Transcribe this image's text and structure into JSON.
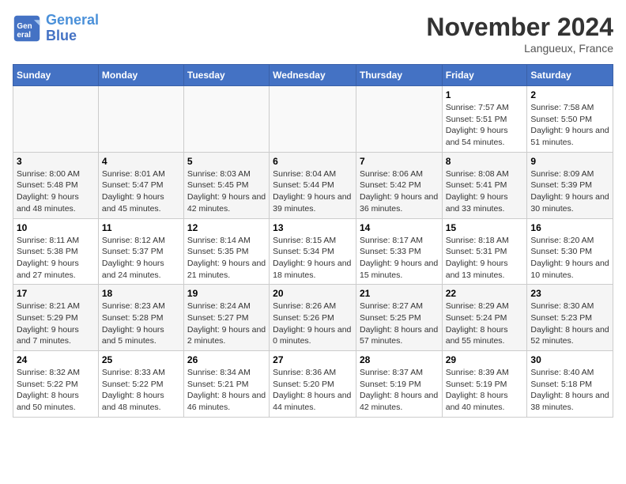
{
  "logo": {
    "line1": "General",
    "line2": "Blue"
  },
  "title": "November 2024",
  "location": "Langueux, France",
  "days_of_week": [
    "Sunday",
    "Monday",
    "Tuesday",
    "Wednesday",
    "Thursday",
    "Friday",
    "Saturday"
  ],
  "weeks": [
    [
      {
        "num": "",
        "detail": ""
      },
      {
        "num": "",
        "detail": ""
      },
      {
        "num": "",
        "detail": ""
      },
      {
        "num": "",
        "detail": ""
      },
      {
        "num": "",
        "detail": ""
      },
      {
        "num": "1",
        "detail": "Sunrise: 7:57 AM\nSunset: 5:51 PM\nDaylight: 9 hours and 54 minutes."
      },
      {
        "num": "2",
        "detail": "Sunrise: 7:58 AM\nSunset: 5:50 PM\nDaylight: 9 hours and 51 minutes."
      }
    ],
    [
      {
        "num": "3",
        "detail": "Sunrise: 8:00 AM\nSunset: 5:48 PM\nDaylight: 9 hours and 48 minutes."
      },
      {
        "num": "4",
        "detail": "Sunrise: 8:01 AM\nSunset: 5:47 PM\nDaylight: 9 hours and 45 minutes."
      },
      {
        "num": "5",
        "detail": "Sunrise: 8:03 AM\nSunset: 5:45 PM\nDaylight: 9 hours and 42 minutes."
      },
      {
        "num": "6",
        "detail": "Sunrise: 8:04 AM\nSunset: 5:44 PM\nDaylight: 9 hours and 39 minutes."
      },
      {
        "num": "7",
        "detail": "Sunrise: 8:06 AM\nSunset: 5:42 PM\nDaylight: 9 hours and 36 minutes."
      },
      {
        "num": "8",
        "detail": "Sunrise: 8:08 AM\nSunset: 5:41 PM\nDaylight: 9 hours and 33 minutes."
      },
      {
        "num": "9",
        "detail": "Sunrise: 8:09 AM\nSunset: 5:39 PM\nDaylight: 9 hours and 30 minutes."
      }
    ],
    [
      {
        "num": "10",
        "detail": "Sunrise: 8:11 AM\nSunset: 5:38 PM\nDaylight: 9 hours and 27 minutes."
      },
      {
        "num": "11",
        "detail": "Sunrise: 8:12 AM\nSunset: 5:37 PM\nDaylight: 9 hours and 24 minutes."
      },
      {
        "num": "12",
        "detail": "Sunrise: 8:14 AM\nSunset: 5:35 PM\nDaylight: 9 hours and 21 minutes."
      },
      {
        "num": "13",
        "detail": "Sunrise: 8:15 AM\nSunset: 5:34 PM\nDaylight: 9 hours and 18 minutes."
      },
      {
        "num": "14",
        "detail": "Sunrise: 8:17 AM\nSunset: 5:33 PM\nDaylight: 9 hours and 15 minutes."
      },
      {
        "num": "15",
        "detail": "Sunrise: 8:18 AM\nSunset: 5:31 PM\nDaylight: 9 hours and 13 minutes."
      },
      {
        "num": "16",
        "detail": "Sunrise: 8:20 AM\nSunset: 5:30 PM\nDaylight: 9 hours and 10 minutes."
      }
    ],
    [
      {
        "num": "17",
        "detail": "Sunrise: 8:21 AM\nSunset: 5:29 PM\nDaylight: 9 hours and 7 minutes."
      },
      {
        "num": "18",
        "detail": "Sunrise: 8:23 AM\nSunset: 5:28 PM\nDaylight: 9 hours and 5 minutes."
      },
      {
        "num": "19",
        "detail": "Sunrise: 8:24 AM\nSunset: 5:27 PM\nDaylight: 9 hours and 2 minutes."
      },
      {
        "num": "20",
        "detail": "Sunrise: 8:26 AM\nSunset: 5:26 PM\nDaylight: 9 hours and 0 minutes."
      },
      {
        "num": "21",
        "detail": "Sunrise: 8:27 AM\nSunset: 5:25 PM\nDaylight: 8 hours and 57 minutes."
      },
      {
        "num": "22",
        "detail": "Sunrise: 8:29 AM\nSunset: 5:24 PM\nDaylight: 8 hours and 55 minutes."
      },
      {
        "num": "23",
        "detail": "Sunrise: 8:30 AM\nSunset: 5:23 PM\nDaylight: 8 hours and 52 minutes."
      }
    ],
    [
      {
        "num": "24",
        "detail": "Sunrise: 8:32 AM\nSunset: 5:22 PM\nDaylight: 8 hours and 50 minutes."
      },
      {
        "num": "25",
        "detail": "Sunrise: 8:33 AM\nSunset: 5:22 PM\nDaylight: 8 hours and 48 minutes."
      },
      {
        "num": "26",
        "detail": "Sunrise: 8:34 AM\nSunset: 5:21 PM\nDaylight: 8 hours and 46 minutes."
      },
      {
        "num": "27",
        "detail": "Sunrise: 8:36 AM\nSunset: 5:20 PM\nDaylight: 8 hours and 44 minutes."
      },
      {
        "num": "28",
        "detail": "Sunrise: 8:37 AM\nSunset: 5:19 PM\nDaylight: 8 hours and 42 minutes."
      },
      {
        "num": "29",
        "detail": "Sunrise: 8:39 AM\nSunset: 5:19 PM\nDaylight: 8 hours and 40 minutes."
      },
      {
        "num": "30",
        "detail": "Sunrise: 8:40 AM\nSunset: 5:18 PM\nDaylight: 8 hours and 38 minutes."
      }
    ]
  ]
}
